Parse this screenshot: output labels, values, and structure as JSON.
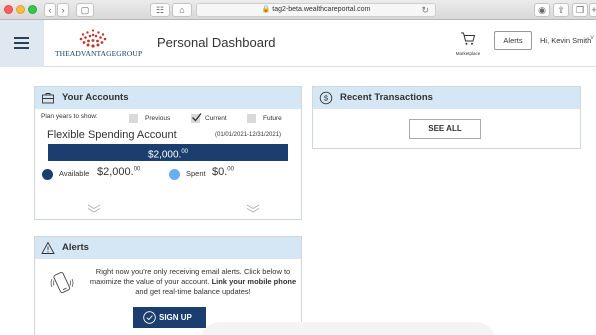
{
  "browser": {
    "url": "tag2-beta.wealthcareportal.com"
  },
  "header": {
    "logo_text": "THEADVANTAGEGROUP",
    "page_title": "Personal Dashboard",
    "marketplace_label": "Marketplace",
    "alerts_label": "Alerts",
    "greeting": "Hi, Kevin Smith"
  },
  "accounts": {
    "title": "Your Accounts",
    "plan_years_label": "Plan years to show:",
    "filters": [
      {
        "label": "Previous",
        "checked": false
      },
      {
        "label": "Current",
        "checked": true
      },
      {
        "label": "Future",
        "checked": false
      }
    ],
    "account_name": "Flexible Spending Account",
    "date_range": "(01/01/2021-12/31/2021)",
    "balance_main": "$2,000.",
    "balance_cents": "00",
    "available_label": "Available",
    "available_main": "$2,000.",
    "available_cents": "00",
    "spent_label": "Spent",
    "spent_main": "$0.",
    "spent_cents": "00",
    "available_fraction": 1.0,
    "colors": {
      "available": "#1b3e6e",
      "spent": "#6aaef0"
    }
  },
  "alerts_panel": {
    "title": "Alerts",
    "message_part1": "Right now you're only receiving email alerts. Click below to maximize the value of your account. ",
    "message_bold": "Link your mobile phone",
    "message_part2": " and get real-time balance updates!",
    "signup_label": "SIGN UP"
  },
  "transactions": {
    "title": "Recent Transactions",
    "see_all_label": "SEE ALL"
  }
}
